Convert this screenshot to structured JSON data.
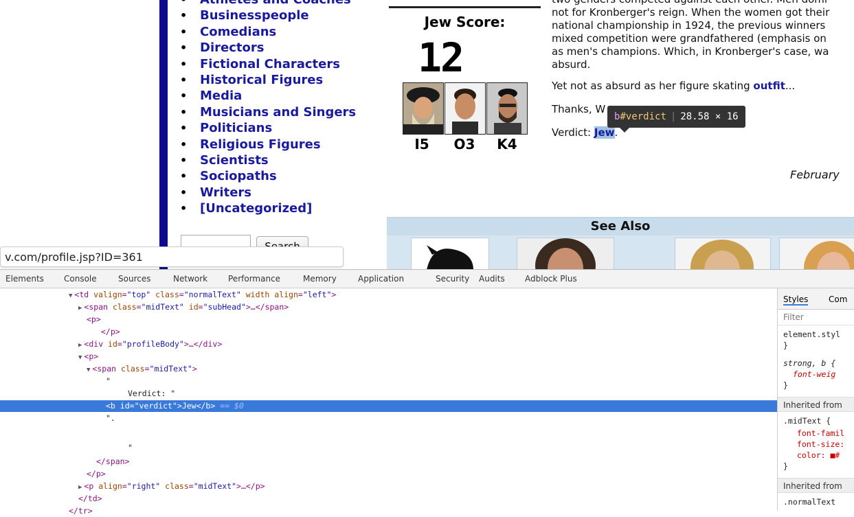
{
  "page": {
    "categories": [
      "Athletes and Coaches",
      "Businesspeople",
      "Comedians",
      "Directors",
      "Fictional Characters",
      "Historical Figures",
      "Media",
      "Musicians and Singers",
      "Politicians",
      "Religious Figures",
      "Scientists",
      "Sociopaths",
      "Writers",
      "[Uncategorized]"
    ],
    "search_button": "Search",
    "score_label": "Jew Score:",
    "score_value": "12",
    "face_codes": [
      "I5",
      "O3",
      "K4"
    ],
    "article_lines": [
      "two genders competed against each other. Men domi",
      "not for Kronberger's reign. When the women got their",
      "national championship in 1924, the previous winners",
      "mixed competition were grandfathered (emphasis on",
      "as men's champions. Which, in Kronberger's case, wa",
      "absurd."
    ],
    "skating_text": "Yet not as absurd as her figure skating ",
    "outfit_link": "outfit",
    "ellipsis": "...",
    "thanks": "Thanks, W",
    "verdict_label": "Verdict: ",
    "verdict_value": "Jew",
    "period": ".",
    "date": "February",
    "see_also": "See Also",
    "url": "v.com/profile.jsp?ID=361"
  },
  "tooltip": {
    "tag": "b",
    "id": "#verdict",
    "size": "28.58 × 16"
  },
  "devtools": {
    "tabs": [
      "Elements",
      "Console",
      "Sources",
      "Network",
      "Performance",
      "Memory",
      "Application",
      "Security",
      "Audits",
      "Adblock Plus"
    ],
    "dom": {
      "td": {
        "tag": "<td ",
        "a1": "valign",
        "v1": "\"top\"",
        "a2": " class",
        "v2": "\"normalText\"",
        "a3": " width",
        "a4": " align",
        "v4": "\"left\"",
        "end": ">"
      },
      "span1": {
        "tag": "<span ",
        "a1": "class",
        "v1": "\"midText\"",
        "a2": " id",
        "v2": "\"subHead\"",
        "rest": ">…</span>"
      },
      "p_open": "<p>",
      "p_close": "</p>",
      "div": {
        "tag": "<div ",
        "a1": "id",
        "v1": "\"profileBody\"",
        "rest": ">…</div>"
      },
      "p2_open": "<p>",
      "span2": {
        "tag": "<span ",
        "a1": "class",
        "v1": "\"midText\"",
        "end": ">"
      },
      "quote1": "\"",
      "verdict_text": "Verdict: \"",
      "b_line": {
        "tag": "<b ",
        "a1": "id",
        "v1": "\"verdict\"",
        "rest": ">Jew</b>",
        "eq": " == $0"
      },
      "dotq": "\".",
      "quote2": "\"",
      "span_close": "</span>",
      "p2_close": "</p>",
      "p3": {
        "tag": "<p ",
        "a1": "align",
        "v1": "\"right\"",
        "a2": " class",
        "v2": "\"midText\"",
        "rest": ">…</p>"
      },
      "td_close": "</td>",
      "tr_close": "</tr>"
    },
    "styles": {
      "tabs": [
        "Styles",
        "Com"
      ],
      "filter": "Filter",
      "element_style": "element.styl",
      "brace_close": "}",
      "strong_rule": "strong, b {",
      "font_weight": "font-weig",
      "inherited1": "Inherited from",
      "midtext_rule": ".midText {",
      "ff": "font-famil",
      "fs": "font-size:",
      "color": "color: ■#",
      "inherited2": "Inherited from",
      "normaltext_rule": ".normalText"
    }
  }
}
